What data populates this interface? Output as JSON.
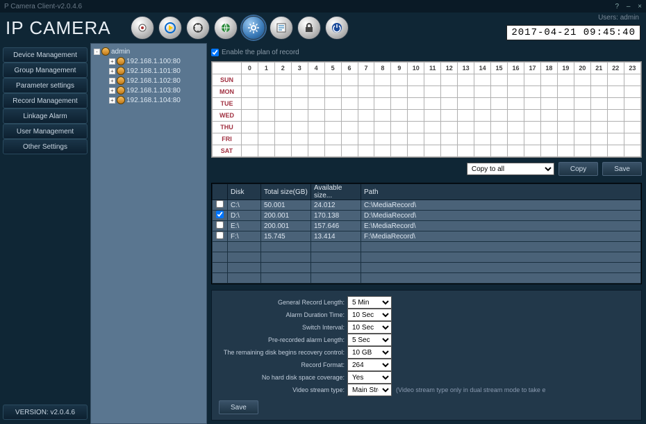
{
  "title_bar": "P Camera Client-v2.0.4.6",
  "logo": "IP CAMERA",
  "user_label": "Users:",
  "user_name": "admin",
  "clock": "2017-04-21 09:45:40",
  "nav": [
    "Device Management",
    "Group Management",
    "Parameter settings",
    "Record Management",
    "Linkage Alarm",
    "User Management",
    "Other Settings"
  ],
  "version": "VERSION: v2.0.4.6",
  "tree_root": "admin",
  "tree_items": [
    "192.168.1.100:80",
    "192.168.1.101:80",
    "192.168.1.102:80",
    "192.168.1.103:80",
    "192.168.1.104:80"
  ],
  "enable_label": "Enable the plan of record",
  "hours": [
    "0",
    "1",
    "2",
    "3",
    "4",
    "5",
    "6",
    "7",
    "8",
    "9",
    "10",
    "11",
    "12",
    "13",
    "14",
    "15",
    "16",
    "17",
    "18",
    "19",
    "20",
    "21",
    "22",
    "23"
  ],
  "days": [
    "SUN",
    "MON",
    "TUE",
    "WED",
    "THU",
    "FRI",
    "SAT"
  ],
  "copy_to_all": "Copy to all",
  "copy_btn": "Copy",
  "save_btn": "Save",
  "disk_headers": {
    "disk": "Disk",
    "total": "Total size(GB)",
    "avail": "Available size...",
    "path": "Path"
  },
  "disks": [
    {
      "chk": false,
      "disk": "C:\\",
      "total": "50.001",
      "avail": "24.012",
      "path": "C:\\MediaRecord\\"
    },
    {
      "chk": true,
      "disk": "D:\\",
      "total": "200.001",
      "avail": "170.138",
      "path": "D:\\MediaRecord\\"
    },
    {
      "chk": false,
      "disk": "E:\\",
      "total": "200.001",
      "avail": "157.646",
      "path": "E:\\MediaRecord\\"
    },
    {
      "chk": false,
      "disk": "F:\\",
      "total": "15.745",
      "avail": "13.414",
      "path": "F:\\MediaRecord\\"
    }
  ],
  "settings": [
    {
      "label": "General Record Length:",
      "value": "5 Min"
    },
    {
      "label": "Alarm Duration Time:",
      "value": "10 Sec"
    },
    {
      "label": "Switch Interval:",
      "value": "10 Sec"
    },
    {
      "label": "Pre-recorded alarm Length:",
      "value": "5 Sec"
    },
    {
      "label": "The remaining disk begins recovery control:",
      "value": "10 GB"
    },
    {
      "label": "Record Format:",
      "value": "264"
    },
    {
      "label": "No hard disk space coverage:",
      "value": "Yes"
    },
    {
      "label": "Video stream type:",
      "value": "Main Stream",
      "hint": "(Video stream type only in dual stream mode to take e"
    }
  ],
  "bottom_save": "Save"
}
